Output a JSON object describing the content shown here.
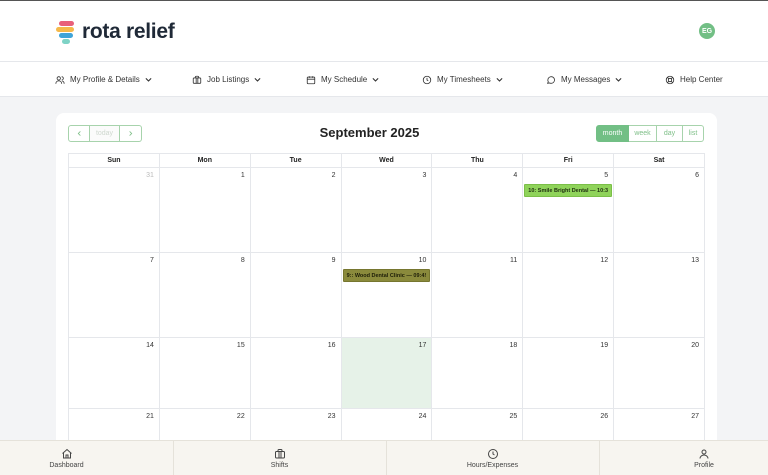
{
  "brand": {
    "name": "rota relief",
    "avatar_initials": "EG"
  },
  "nav": [
    {
      "label": "My Profile & Details",
      "icon": "users-icon",
      "dropdown": true
    },
    {
      "label": "Job Listings",
      "icon": "briefcase-icon",
      "dropdown": true
    },
    {
      "label": "My Schedule",
      "icon": "calendar-icon",
      "dropdown": true
    },
    {
      "label": "My Timesheets",
      "icon": "clock-icon",
      "dropdown": true
    },
    {
      "label": "My Messages",
      "icon": "message-icon",
      "dropdown": true
    },
    {
      "label": "Help Center",
      "icon": "lifebuoy-icon",
      "dropdown": false
    }
  ],
  "calendar": {
    "title": "September 2025",
    "prev_label": "<",
    "today_label": "today",
    "next_label": ">",
    "views": [
      "month",
      "week",
      "day",
      "list"
    ],
    "active_view": "month",
    "weekdays": [
      "Sun",
      "Mon",
      "Tue",
      "Wed",
      "Thu",
      "Fri",
      "Sat"
    ],
    "weeks": [
      [
        "31",
        "1",
        "2",
        "3",
        "4",
        "5",
        "6"
      ],
      [
        "7",
        "8",
        "9",
        "10",
        "11",
        "12",
        "13"
      ],
      [
        "14",
        "15",
        "16",
        "17",
        "18",
        "19",
        "20"
      ],
      [
        "21",
        "22",
        "23",
        "24",
        "25",
        "26",
        "27"
      ]
    ],
    "events": {
      "smile": "10: Smile Bright Dental — 10:3",
      "wood": "9:: Wood Dental Clinic — 09:4!"
    },
    "colors": {
      "accent": "#72bf85",
      "today_bg": "#e6f2e8",
      "event_green": "#8fd35a",
      "event_olive": "#8a8a3c"
    }
  },
  "tabbar": [
    {
      "label": "Dashboard",
      "icon": "home-icon"
    },
    {
      "label": "Shifts",
      "icon": "briefcase-icon"
    },
    {
      "label": "Hours/Expenses",
      "icon": "clock-icon"
    },
    {
      "label": "Profile",
      "icon": "user-icon"
    }
  ]
}
